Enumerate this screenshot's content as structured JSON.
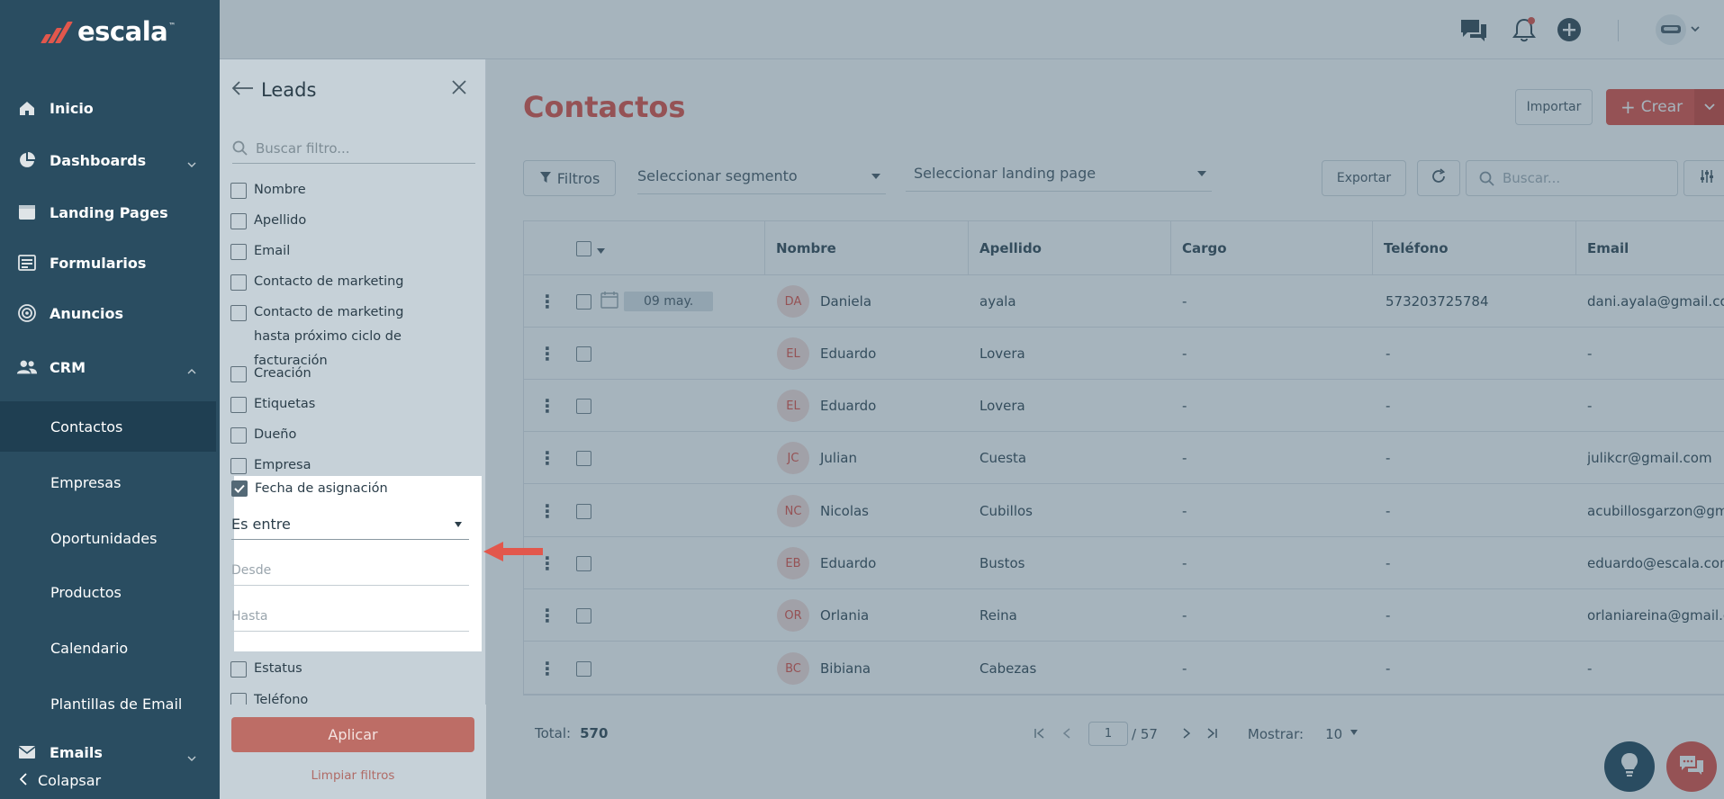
{
  "app": {
    "logo_text": "escala",
    "logo_tm": "™"
  },
  "sidebar": {
    "items": [
      {
        "label": "Inicio",
        "icon": "home-icon"
      },
      {
        "label": "Dashboards",
        "icon": "pie-chart-icon"
      },
      {
        "label": "Landing Pages",
        "icon": "browser-icon"
      },
      {
        "label": "Formularios",
        "icon": "form-icon"
      },
      {
        "label": "Anuncios",
        "icon": "target-icon"
      },
      {
        "label": "CRM",
        "icon": "users-icon"
      }
    ],
    "crm_sub": [
      "Contactos",
      "Empresas",
      "Oportunidades",
      "Productos",
      "Calendario",
      "Plantillas de Email"
    ],
    "emails_label": "Emails",
    "collapse_label": "Colapsar"
  },
  "page": {
    "title": "Contactos",
    "import_label": "Importar",
    "create_label": "Crear",
    "filters_label": "Filtros",
    "segment_placeholder": "Seleccionar segmento",
    "landing_placeholder": "Seleccionar landing page",
    "export_label": "Exportar",
    "search_placeholder": "Buscar..."
  },
  "table": {
    "columns": [
      "Nombre",
      "Apellido",
      "Cargo",
      "Teléfono",
      "Email"
    ],
    "rows": [
      {
        "initials": "DA",
        "nombre": "Daniela",
        "apellido": "ayala",
        "cargo": "-",
        "telefono": "573203725784",
        "email": "dani.ayala@gmail.com",
        "date": "09 may."
      },
      {
        "initials": "EL",
        "nombre": "Eduardo",
        "apellido": "Lovera",
        "cargo": "-",
        "telefono": "-",
        "email": "-"
      },
      {
        "initials": "EL",
        "nombre": "Eduardo",
        "apellido": "Lovera",
        "cargo": "-",
        "telefono": "-",
        "email": "-"
      },
      {
        "initials": "JC",
        "nombre": "Julian",
        "apellido": "Cuesta",
        "cargo": "-",
        "telefono": "-",
        "email": "julikcr@gmail.com"
      },
      {
        "initials": "NC",
        "nombre": "Nicolas",
        "apellido": "Cubillos",
        "cargo": "-",
        "telefono": "-",
        "email": "acubillosgarzon@gm"
      },
      {
        "initials": "EB",
        "nombre": "Eduardo",
        "apellido": "Bustos",
        "cargo": "-",
        "telefono": "-",
        "email": "eduardo@escala.com"
      },
      {
        "initials": "OR",
        "nombre": "Orlania",
        "apellido": "Reina",
        "cargo": "-",
        "telefono": "-",
        "email": "orlaniareina@gmail.c"
      },
      {
        "initials": "BC",
        "nombre": "Bibiana",
        "apellido": "Cabezas",
        "cargo": "-",
        "telefono": "-",
        "email": "-"
      }
    ]
  },
  "footer": {
    "total_label": "Total:",
    "total_value": "570",
    "current_page": "1",
    "total_pages": "/ 57",
    "show_label": "Mostrar:",
    "show_value": "10"
  },
  "filter_panel": {
    "title": "Leads",
    "search_placeholder": "Buscar filtro...",
    "fields": [
      "Nombre",
      "Apellido",
      "Email",
      "Contacto de marketing",
      "Contacto de marketing hasta próximo ciclo de facturación",
      "Creación",
      "Etiquetas",
      "Dueño",
      "Empresa"
    ],
    "active_field": "Fecha de asignación",
    "operator": "Es entre",
    "from_placeholder": "Desde",
    "to_placeholder": "Hasta",
    "after_fields": [
      "Estatus",
      "Teléfono"
    ],
    "apply_label": "Aplicar",
    "clear_label": "Limpiar filtros"
  },
  "colors": {
    "brand": "#e2574c",
    "sidebar": "#2a4d61"
  }
}
